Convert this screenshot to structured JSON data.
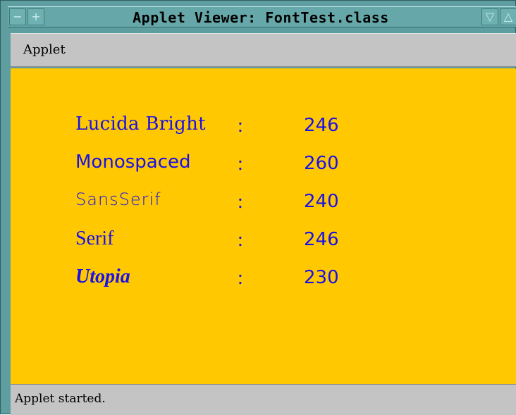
{
  "window": {
    "title": "Applet Viewer: FontTest.class",
    "icons": {
      "menu": "minus-icon",
      "pin": "plus-icon",
      "minimize": "triangle-down-icon",
      "maximize": "triangle-up-icon"
    },
    "colors": {
      "frame": "#5f9ea0",
      "canvas": "#ffc800",
      "text": "#1a10e8",
      "panel": "#c4c4c4"
    }
  },
  "menubar": {
    "applet_label": "Applet"
  },
  "fonts": [
    {
      "name": "Lucida Bright",
      "sep": ":",
      "value": "246"
    },
    {
      "name": "Monospaced",
      "sep": ":",
      "value": "260"
    },
    {
      "name": "SansSerif",
      "sep": ":",
      "value": "240"
    },
    {
      "name": "Serif",
      "sep": ":",
      "value": "246"
    },
    {
      "name": "Utopia",
      "sep": ":",
      "value": "230"
    }
  ],
  "status": {
    "text": "Applet started."
  }
}
